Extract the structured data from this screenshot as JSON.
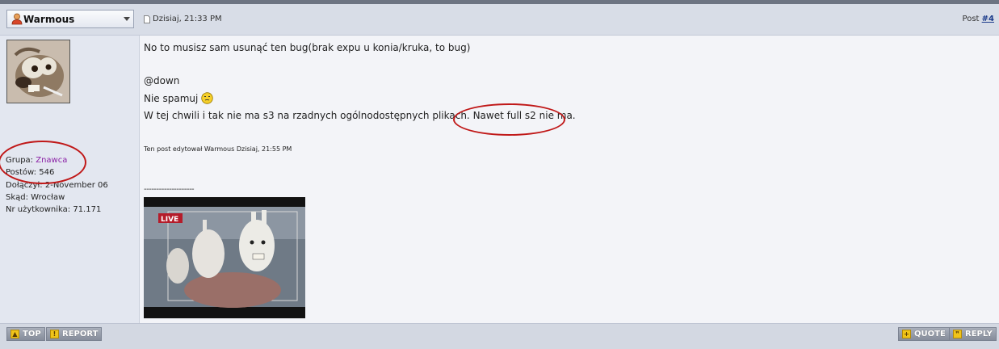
{
  "post": {
    "username": "Warmous",
    "date": "Dzisiaj, 21:33 PM",
    "post_label": "Post ",
    "post_number": "#4"
  },
  "user_info": {
    "group_label": "Grupa: ",
    "group_value": "Znawca",
    "posts": "Postów: 546",
    "joined": "Dołączył: 2-November 06",
    "location": "Skąd: Wrocław",
    "user_number": "Nr użytkownika: 71.171"
  },
  "body": {
    "line1": "No to musisz sam usunąć ten bug(brak expu u konia/kruka, to bug)",
    "line2": "@down",
    "line3": "Nie spamuj",
    "line4_a": "W tej chwili i tak nie ma s3 na rzadnych ogólnodostępnych plikach. ",
    "line4_b": "Nawet full s2 nie ma.",
    "edit_note": "Ten post edytował Warmous Dzisiaj, 21:55 PM",
    "sig_line": "--------------------",
    "live_badge": "LIVE"
  },
  "footer": {
    "top": "TOP",
    "report": "REPORT",
    "quote": "QUOTE",
    "reply": "REPLY"
  },
  "colors": {
    "group": "#8a1fa5",
    "annotation": "#c01818",
    "button": "#868d9b"
  }
}
